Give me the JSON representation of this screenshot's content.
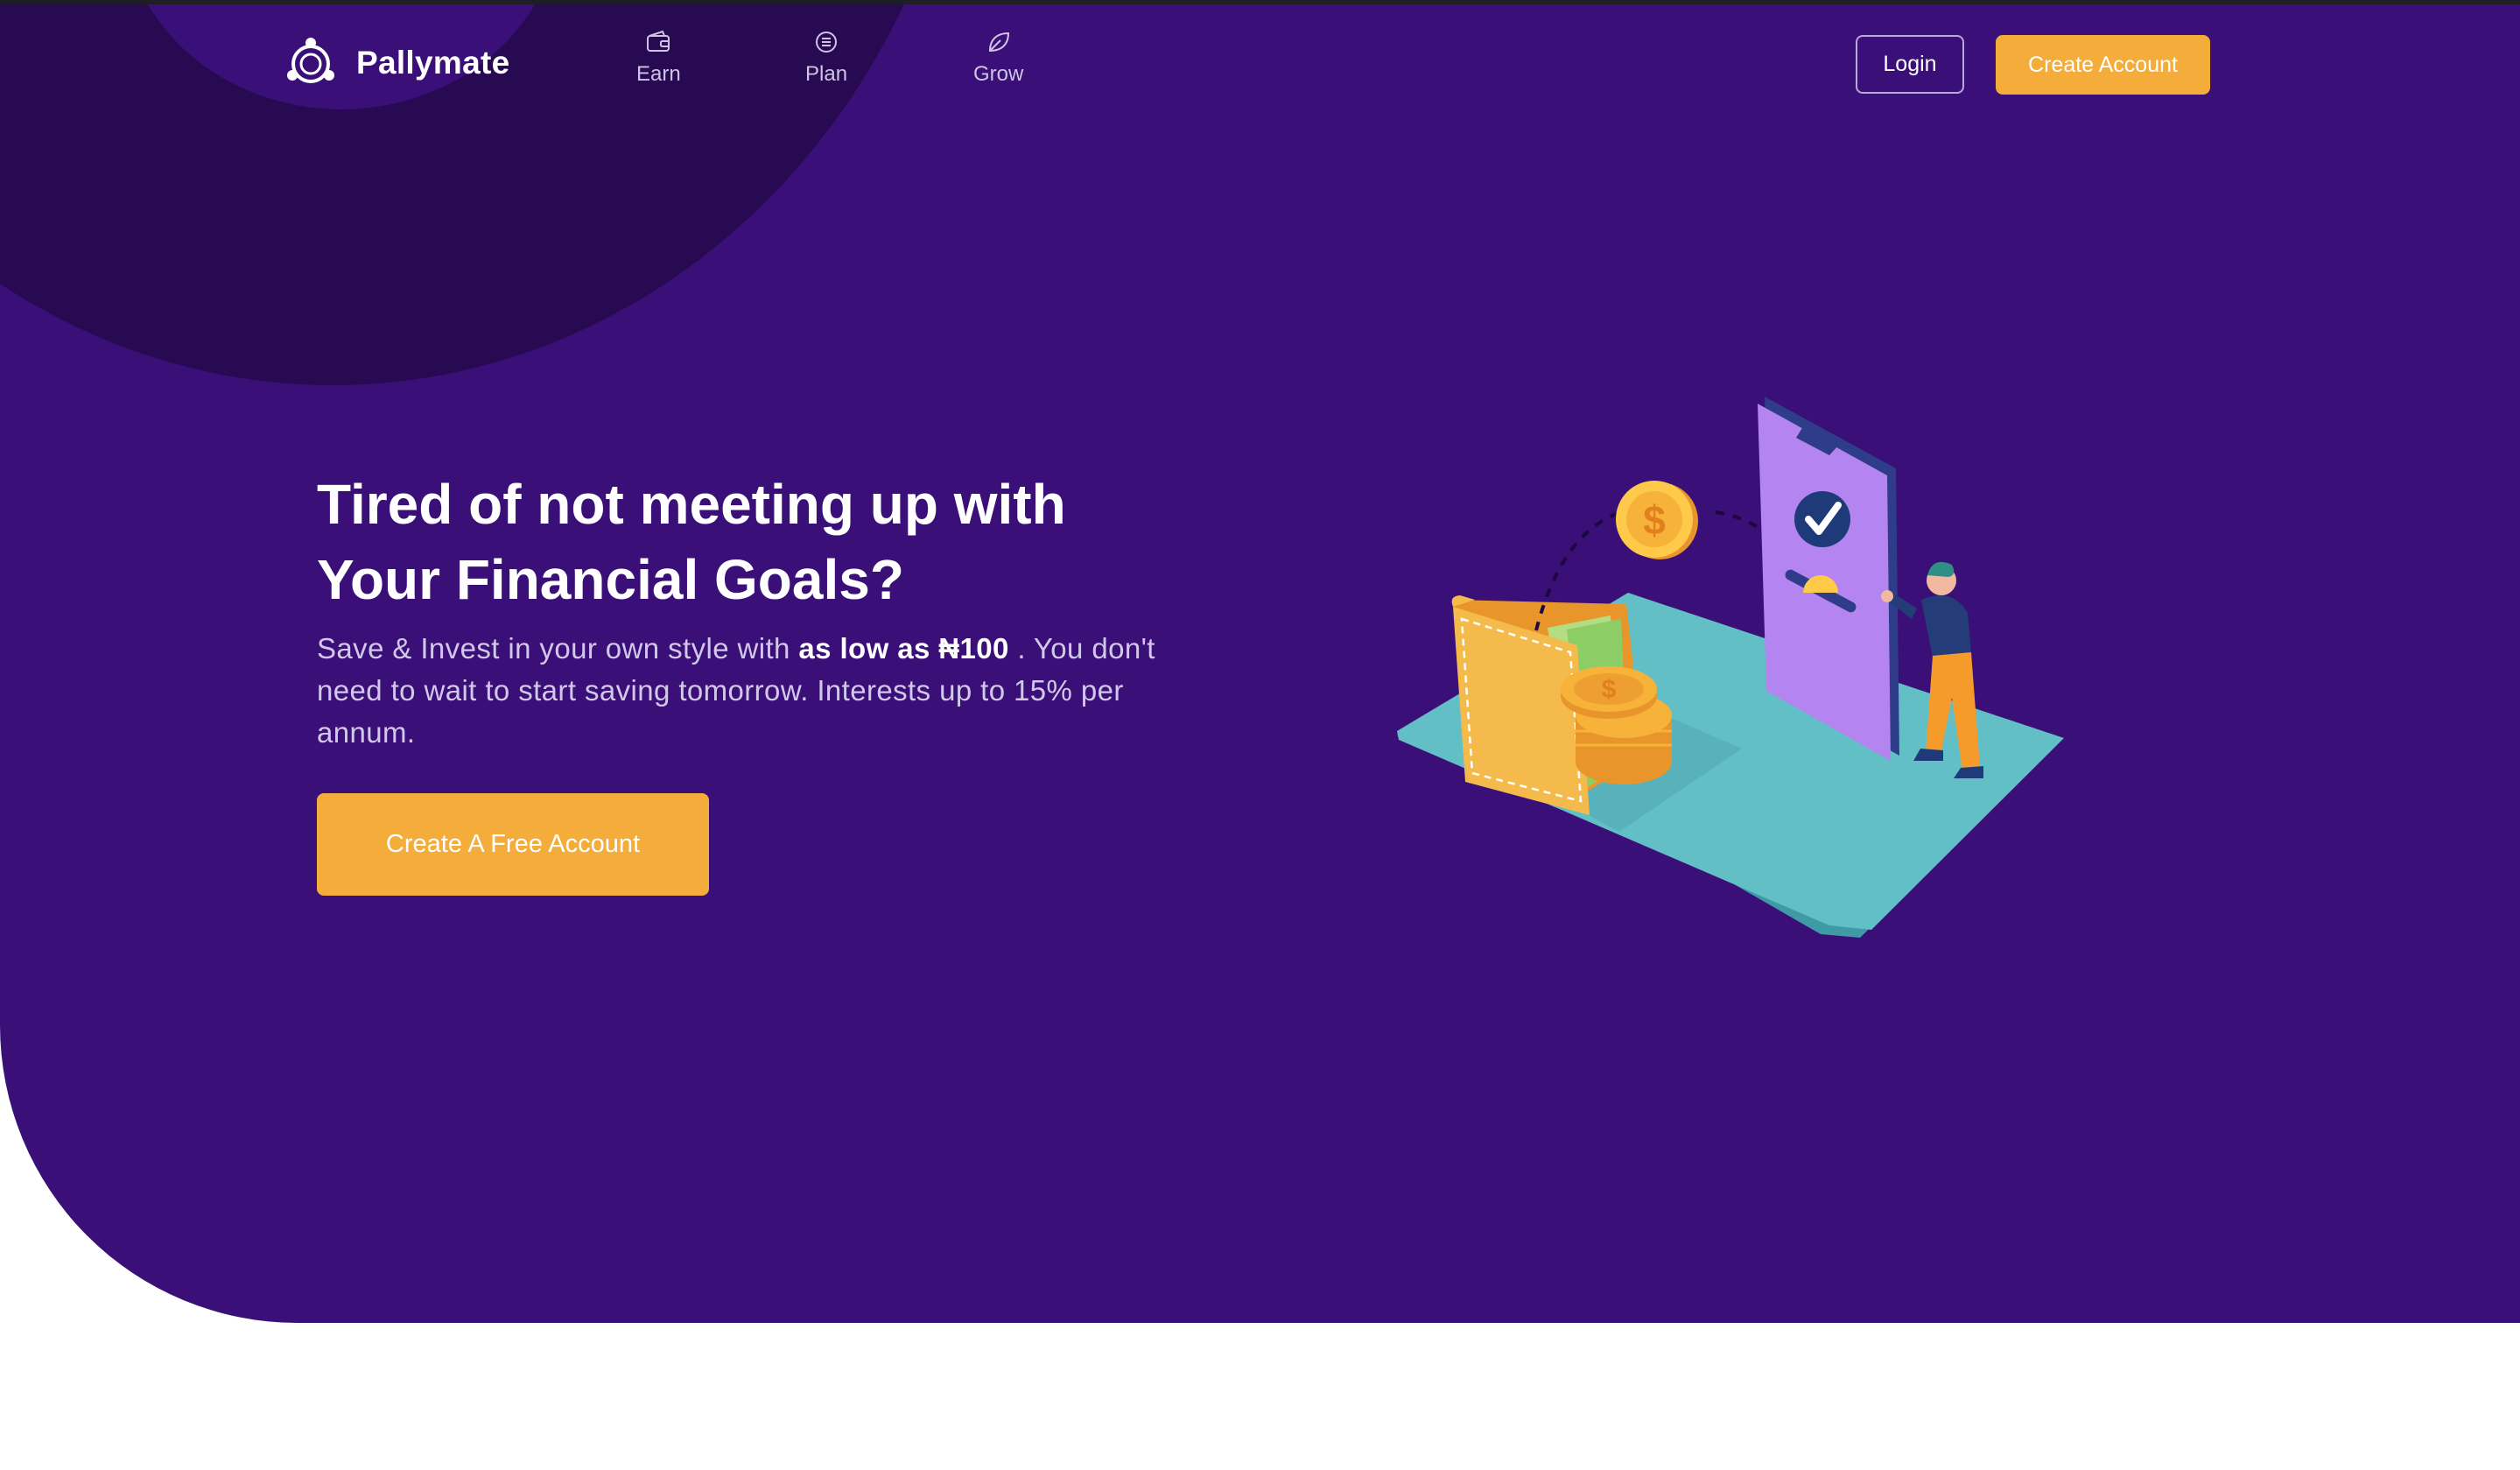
{
  "brand": {
    "name": "Pallymate",
    "logo_icon": "pallymate-logo-icon"
  },
  "nav": {
    "items": [
      {
        "label": "Earn",
        "icon": "wallet-icon"
      },
      {
        "label": "Plan",
        "icon": "list-circle-icon"
      },
      {
        "label": "Grow",
        "icon": "leaf-icon"
      }
    ]
  },
  "header": {
    "login_label": "Login",
    "create_account_label": "Create Account"
  },
  "hero": {
    "headline": "Tired of not meeting up with Your Financial Goals?",
    "sub_before": "Save & Invest in your own style with ",
    "sub_bold": "as low as ₦100",
    "sub_after": " . You don't need to wait to start saving tomorrow. Interests up to 15% per annum.",
    "cta_label": "Create A Free Account"
  },
  "colors": {
    "hero_bg": "#3a0f78",
    "dark_circle": "#270a52",
    "accent_orange": "#f4ac3b",
    "platform_teal": "#63bfc6",
    "phone_purple": "#b484f0"
  }
}
